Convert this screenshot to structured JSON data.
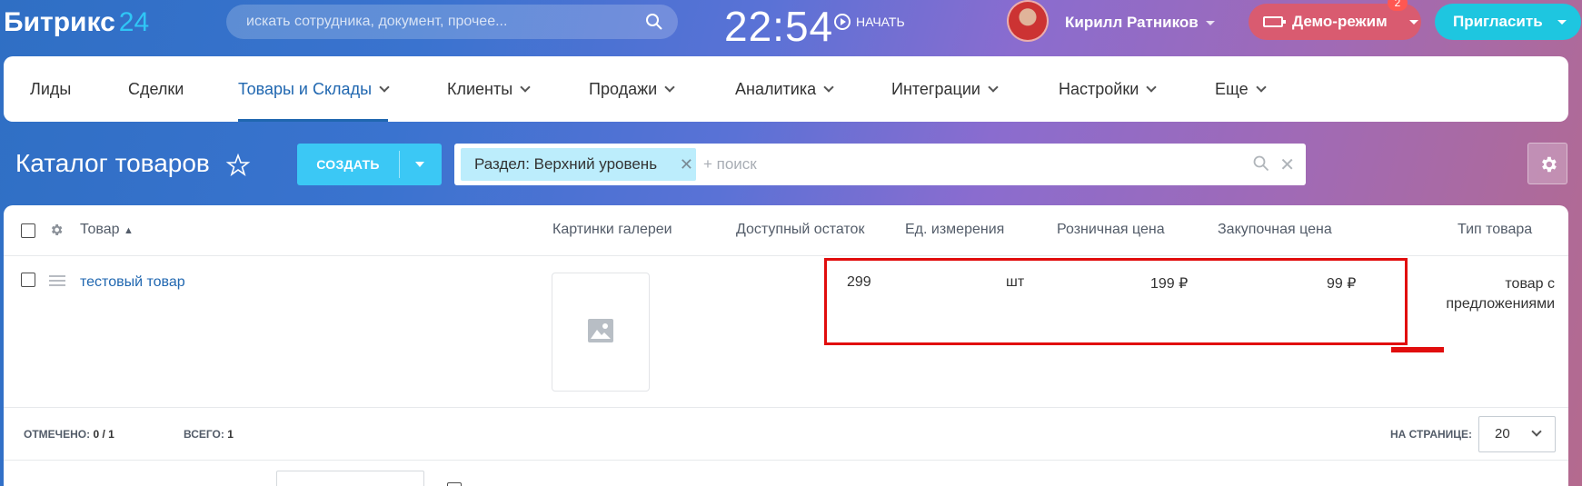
{
  "header": {
    "logo_text": "Битрикс",
    "logo_number": "24",
    "search_placeholder": "искать сотрудника, документ, прочее...",
    "clock": "22:54",
    "start_label": "НАЧАТЬ",
    "user_name": "Кирилл Ратников",
    "demo_label": "Демо-режим",
    "demo_badge": "2",
    "invite_label": "Пригласить"
  },
  "nav": {
    "items": [
      {
        "label": "Лиды"
      },
      {
        "label": "Сделки"
      },
      {
        "label": "Товары и Склады"
      },
      {
        "label": "Клиенты"
      },
      {
        "label": "Продажи"
      },
      {
        "label": "Аналитика"
      },
      {
        "label": "Интеграции"
      },
      {
        "label": "Настройки"
      },
      {
        "label": "Еще"
      }
    ],
    "active": "Товары и Склады"
  },
  "page": {
    "title": "Каталог товаров",
    "create_label": "СОЗДАТЬ",
    "filter_chip": "Раздел: Верхний уровень",
    "filter_placeholder": "+ поиск"
  },
  "grid": {
    "columns": [
      "Товар",
      "Картинки галереи",
      "Доступный остаток",
      "Ед. измерения",
      "Розничная цена",
      "Закупочная цена",
      "Тип товара"
    ],
    "rows": [
      {
        "name": "тестовый товар",
        "stock": "299",
        "unit": "шт",
        "retail_price": "199 ₽",
        "purchase_price": "99 ₽",
        "type_line1": "товар с",
        "type_line2": "предложениями"
      }
    ],
    "footer": {
      "checked_label": "ОТМЕЧЕНО:",
      "checked_value": "0 / 1",
      "total_label": "ВСЕГО:",
      "total_value": "1",
      "per_page_label": "НА СТРАНИЦЕ:",
      "per_page_value": "20"
    }
  },
  "colors": {
    "accent": "#2067b0",
    "create_button": "#3bc8f5",
    "invite_button": "#1ec6e0",
    "demo_button": "#d95b70",
    "highlight": "#e10d0d"
  }
}
